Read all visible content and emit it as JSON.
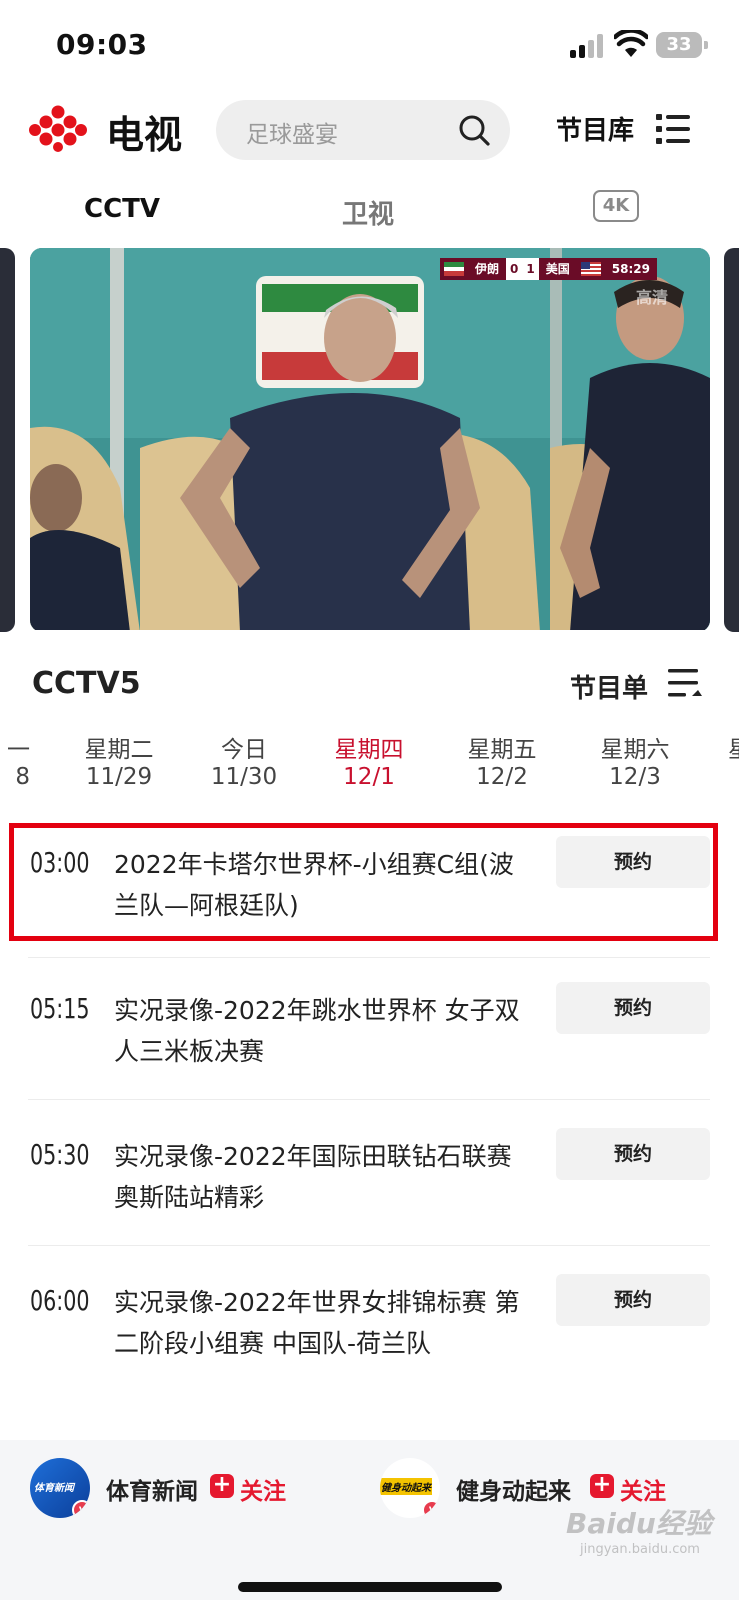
{
  "status": {
    "time": "09:03",
    "battery": "33"
  },
  "header": {
    "app_title": "电视",
    "search_placeholder": "足球盛宴",
    "library_label": "节目库"
  },
  "tabs": [
    {
      "label": "CCTV"
    },
    {
      "label": "卫视"
    },
    {
      "label": "4K"
    }
  ],
  "video": {
    "team_home": "伊朗",
    "score_home": "0",
    "score_away": "1",
    "team_away": "美国",
    "clock": "58:29",
    "quality": "高清"
  },
  "schedule": {
    "channel": "CCTV5",
    "listing_label": "节目单",
    "days": [
      {
        "weekday": "一",
        "date": "8"
      },
      {
        "weekday": "星期二",
        "date": "11/29"
      },
      {
        "weekday": "今日",
        "date": "11/30"
      },
      {
        "weekday": "星期四",
        "date": "12/1"
      },
      {
        "weekday": "星期五",
        "date": "12/2"
      },
      {
        "weekday": "星期六",
        "date": "12/3"
      },
      {
        "weekday": "星",
        "date": ""
      }
    ],
    "active_day": "星期四",
    "programs": [
      {
        "time": "03:00",
        "title": "2022年卡塔尔世界杯-小组赛C组(波兰队—阿根廷队)",
        "action": "预约"
      },
      {
        "time": "05:15",
        "title": "实况录像-2022年跳水世界杯 女子双人三米板决赛",
        "action": "预约"
      },
      {
        "time": "05:30",
        "title": "实况录像-2022年国际田联钻石联赛 奥斯陆站精彩",
        "action": "预约"
      },
      {
        "time": "06:00",
        "title": "实况录像-2022年世界女排锦标赛 第二阶段小组赛  中国队-荷兰队",
        "action": "预约"
      }
    ]
  },
  "footer": {
    "items": [
      {
        "name": "体育新闻",
        "follow": "关注",
        "avatar_text": "体育新闻"
      },
      {
        "name": "健身动起来",
        "follow": "关注",
        "avatar_text": "健身动起来"
      }
    ],
    "watermark": "Baidu经验",
    "watermark_sub": "jingyan.baidu.com"
  },
  "colors": {
    "accent": "#c8102e",
    "highlight": "#e30010",
    "follow": "#e5192f"
  }
}
